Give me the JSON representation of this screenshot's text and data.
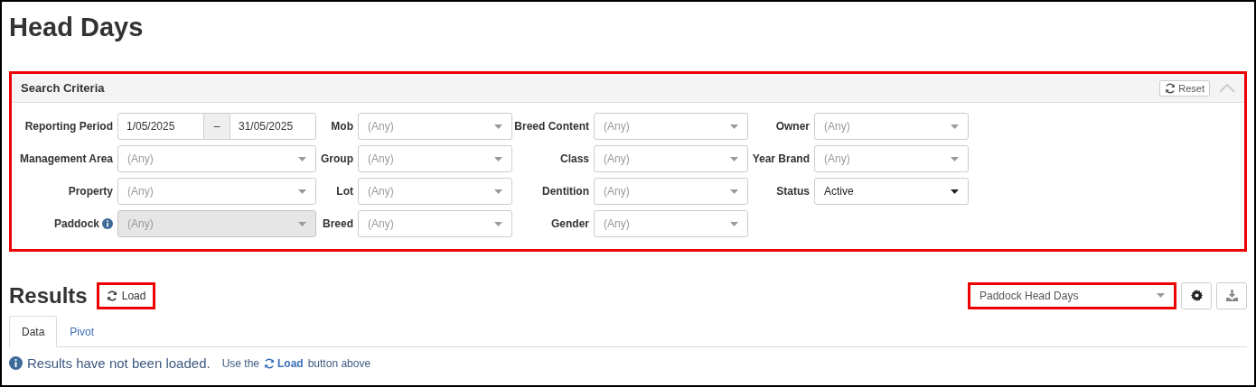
{
  "page": {
    "title": "Head Days"
  },
  "search_criteria": {
    "title": "Search Criteria",
    "reset_button": "Reset",
    "expanded": true,
    "fields": [
      {
        "kind": "date_range",
        "label": "Reporting Period",
        "from": "1/05/2025",
        "separator": "–",
        "to": "31/05/2025",
        "disabled": false,
        "info": false
      },
      {
        "kind": "select",
        "label": "Mob",
        "placeholder": "(Any)",
        "disabled": false,
        "info": false
      },
      {
        "kind": "select",
        "label": "Breed Content",
        "placeholder": "(Any)",
        "disabled": false,
        "info": false
      },
      {
        "kind": "select",
        "label": "Owner",
        "placeholder": "(Any)",
        "disabled": false,
        "info": false
      },
      {
        "kind": "select",
        "label": "Management Area",
        "placeholder": "(Any)",
        "disabled": false,
        "info": false
      },
      {
        "kind": "select",
        "label": "Group",
        "placeholder": "(Any)",
        "disabled": false,
        "info": false
      },
      {
        "kind": "select",
        "label": "Class",
        "placeholder": "(Any)",
        "disabled": false,
        "info": false
      },
      {
        "kind": "select",
        "label": "Year Brand",
        "placeholder": "(Any)",
        "disabled": false,
        "info": false
      },
      {
        "kind": "select",
        "label": "Property",
        "placeholder": "(Any)",
        "disabled": false,
        "info": false
      },
      {
        "kind": "select",
        "label": "Lot",
        "placeholder": "(Any)",
        "disabled": false,
        "info": false
      },
      {
        "kind": "select",
        "label": "Dentition",
        "placeholder": "(Any)",
        "disabled": false,
        "info": false
      },
      {
        "kind": "select",
        "label": "Status",
        "value": "Active",
        "disabled": false,
        "info": false
      },
      {
        "kind": "select",
        "label": "Paddock",
        "placeholder": "(Any)",
        "disabled": true,
        "info": true
      },
      {
        "kind": "select",
        "label": "Breed",
        "placeholder": "(Any)",
        "disabled": false,
        "info": false
      },
      {
        "kind": "select",
        "label": "Gender",
        "placeholder": "(Any)",
        "disabled": false,
        "info": false
      }
    ]
  },
  "results": {
    "title": "Results",
    "load_button": "Load",
    "report_select": "Paddock Head Days",
    "tabs": [
      {
        "label": "Data",
        "selected": true
      },
      {
        "label": "Pivot",
        "selected": false
      }
    ],
    "message": "Results have not been loaded.",
    "hint_prefix": "Use the",
    "hint_link": "Load",
    "hint_suffix": "button above"
  }
}
